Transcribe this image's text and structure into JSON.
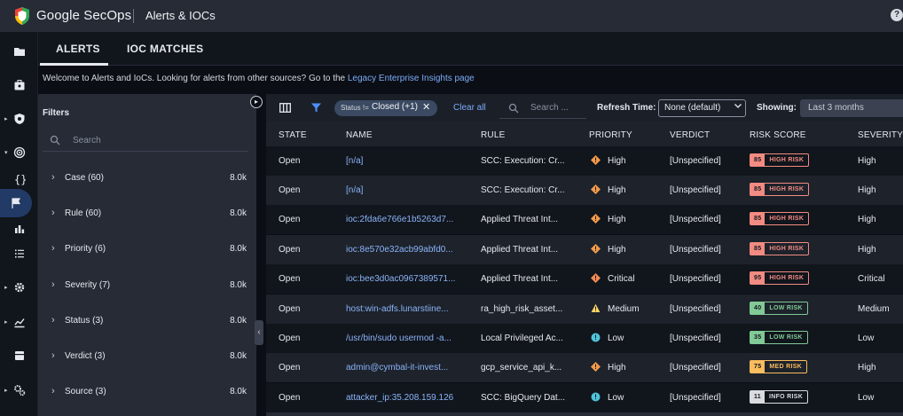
{
  "header": {
    "brand": "Google SecOps",
    "page_title": "Alerts & IOCs",
    "help_glyph": "?"
  },
  "tabs": [
    {
      "label": "ALERTS",
      "active": true
    },
    {
      "label": "IOC MATCHES",
      "active": false
    }
  ],
  "welcome": {
    "text": "Welcome to Alerts and IoCs. Looking for alerts from other sources? Go to the",
    "link": "Legacy Enterprise Insights page"
  },
  "filters": {
    "title": "Filters",
    "search_placeholder": "Search",
    "items": [
      {
        "label": "Case (60)",
        "count": "8.0k"
      },
      {
        "label": "Rule (60)",
        "count": "8.0k"
      },
      {
        "label": "Priority (6)",
        "count": "8.0k"
      },
      {
        "label": "Severity (7)",
        "count": "8.0k"
      },
      {
        "label": "Status (3)",
        "count": "8.0k"
      },
      {
        "label": "Verdict (3)",
        "count": "8.0k"
      },
      {
        "label": "Source (3)",
        "count": "8.0k"
      }
    ]
  },
  "toolbar": {
    "chip_prefix": "Status !=",
    "chip_value": "Closed (+1)",
    "chip_close": "✕",
    "clear_all": "Clear all",
    "search_placeholder": "Search ...",
    "refresh_label": "Refresh Time:",
    "refresh_value": "None (default)",
    "showing_label": "Showing:",
    "showing_value": "Last 3 months"
  },
  "table": {
    "columns": [
      "STATE",
      "NAME",
      "RULE",
      "PRIORITY",
      "VERDICT",
      "RISK SCORE",
      "SEVERITY"
    ],
    "rows": [
      {
        "state": "Open",
        "name": "[n/a]",
        "rule": "SCC: Execution: Cr...",
        "priority": "High",
        "verdict": "[Unspecified]",
        "risk_score": "85",
        "risk_label": "HIGH RISK",
        "severity": "High"
      },
      {
        "state": "Open",
        "name": "[n/a]",
        "rule": "SCC: Execution: Cr...",
        "priority": "High",
        "verdict": "[Unspecified]",
        "risk_score": "85",
        "risk_label": "HIGH RISK",
        "severity": "High"
      },
      {
        "state": "Open",
        "name": "ioc:2fda6e766e1b5263d7...",
        "rule": "Applied Threat Int...",
        "priority": "High",
        "verdict": "[Unspecified]",
        "risk_score": "85",
        "risk_label": "HIGH RISK",
        "severity": "High"
      },
      {
        "state": "Open",
        "name": "ioc:8e570e32acb99abfd0...",
        "rule": "Applied Threat Int...",
        "priority": "High",
        "verdict": "[Unspecified]",
        "risk_score": "85",
        "risk_label": "HIGH RISK",
        "severity": "High"
      },
      {
        "state": "Open",
        "name": "ioc:bee3d0ac0967389571...",
        "rule": "Applied Threat Int...",
        "priority": "Critical",
        "verdict": "[Unspecified]",
        "risk_score": "95",
        "risk_label": "HIGH RISK",
        "severity": "Critical"
      },
      {
        "state": "Open",
        "name": "host:win-adfs.lunarstiine...",
        "rule": "ra_high_risk_asset...",
        "priority": "Medium",
        "verdict": "[Unspecified]",
        "risk_score": "40",
        "risk_label": "LOW RISK",
        "severity": "Medium"
      },
      {
        "state": "Open",
        "name": "/usr/bin/sudo usermod -a...",
        "rule": "Local Privileged Ac...",
        "priority": "Low",
        "verdict": "[Unspecified]",
        "risk_score": "35",
        "risk_label": "LOW RISK",
        "severity": "Low"
      },
      {
        "state": "Open",
        "name": "admin@cymbal-it-invest...",
        "rule": "gcp_service_api_k...",
        "priority": "High",
        "verdict": "[Unspecified]",
        "risk_score": "75",
        "risk_label": "MED RISK",
        "severity": "High"
      },
      {
        "state": "Open",
        "name": "attacker_ip:35.208.159.126",
        "rule": "SCC: BigQuery Dat...",
        "priority": "Low",
        "verdict": "[Unspecified]",
        "risk_score": "11",
        "risk_label": "INFO RISK",
        "severity": "Low"
      }
    ]
  },
  "colors": {
    "high_risk": "#f28b82",
    "low_risk": "#81c995",
    "med_risk": "#fbbc5e",
    "info_risk": "#dadce0",
    "link": "#8ab4f8",
    "accent": "#7cacf8"
  }
}
